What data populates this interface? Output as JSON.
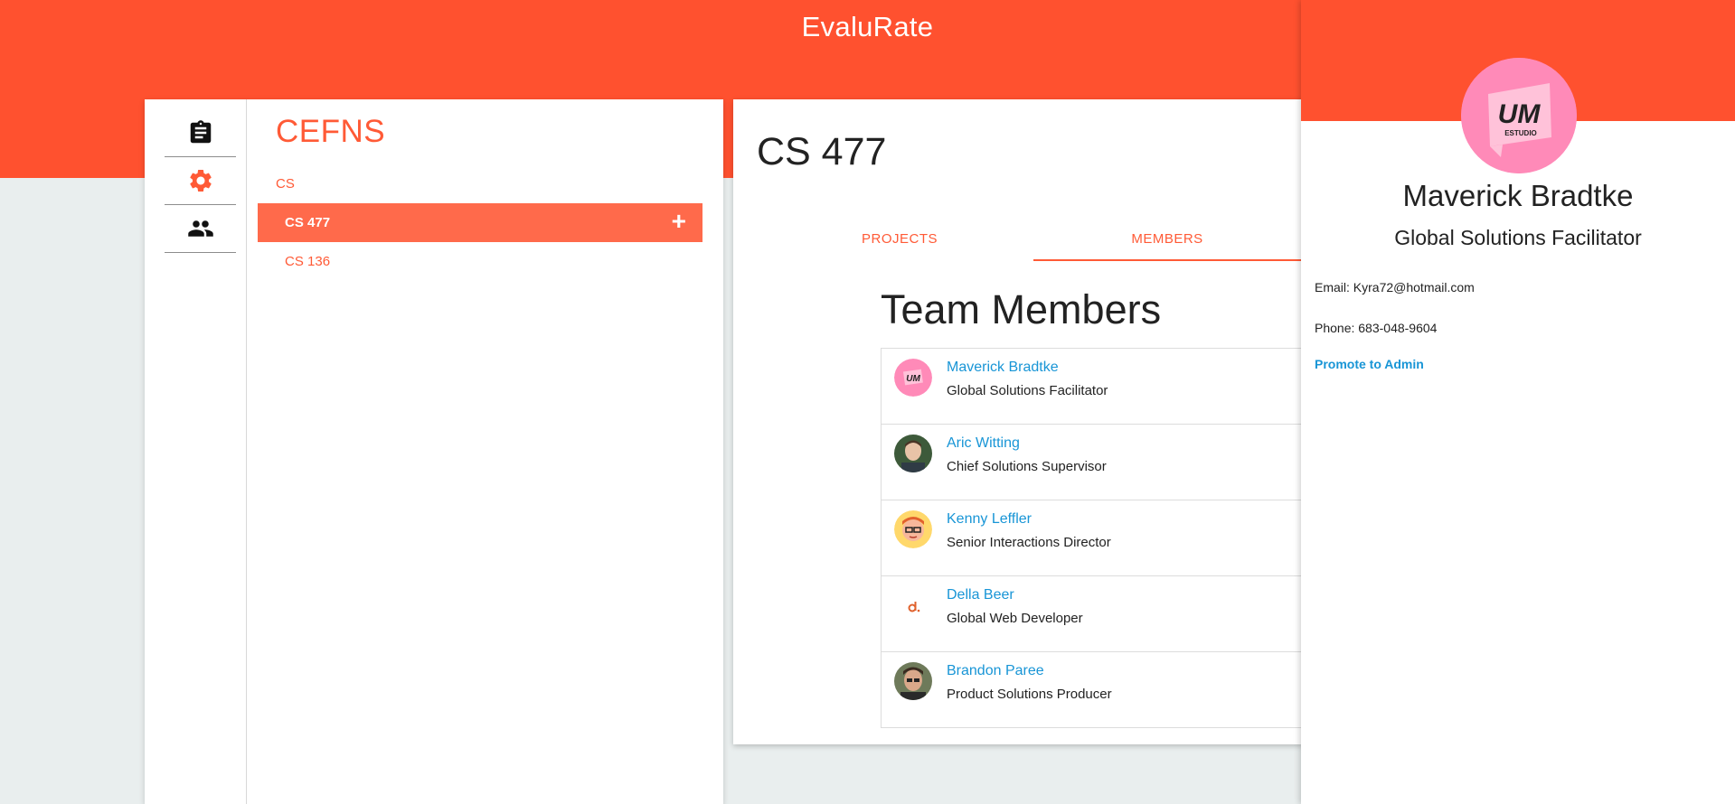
{
  "app": {
    "title": "EvaluRate"
  },
  "sidebar": {
    "rail": [
      {
        "icon": "clipboard-icon",
        "color": "#111111"
      },
      {
        "icon": "gear-icon",
        "color": "#ff5a36"
      },
      {
        "icon": "people-icon",
        "color": "#111111"
      }
    ],
    "org_title": "CEFNS",
    "department": "CS",
    "courses": [
      {
        "label": "CS 477",
        "active": true,
        "action_icon": "plus-icon",
        "action_label": "+"
      },
      {
        "label": "CS 136",
        "active": false
      }
    ]
  },
  "course": {
    "title": "CS 477",
    "tabs": [
      {
        "label": "PROJECTS",
        "active": false
      },
      {
        "label": "MEMBERS",
        "active": true
      }
    ],
    "team_heading": "Team Members",
    "members": [
      {
        "name": "Maverick Bradtke",
        "role": "Global Solutions Facilitator",
        "avatar": "um-estudio-logo"
      },
      {
        "name": "Aric Witting",
        "role": "Chief Solutions Supervisor",
        "avatar": "photo-person"
      },
      {
        "name": "Kenny Leffler",
        "role": "Senior Interactions Director",
        "avatar": "cartoon-face"
      },
      {
        "name": "Della Beer",
        "role": "Global Web Developer",
        "avatar": "d-logo"
      },
      {
        "name": "Brandon Paree",
        "role": "Product Solutions Producer",
        "avatar": "photo-person"
      }
    ]
  },
  "profile": {
    "name": "Maverick Bradtke",
    "role": "Global Solutions Facilitator",
    "email_line": "Email: Kyra72@hotmail.com",
    "phone_line": "Phone: 683-048-9604",
    "promote_label": "Promote to Admin",
    "avatar_logo_text": "UM",
    "avatar_logo_subtext": "ESTUDIO"
  },
  "colors": {
    "brand": "#ff512f",
    "accent": "#ff5a36",
    "link": "#1895d6"
  }
}
